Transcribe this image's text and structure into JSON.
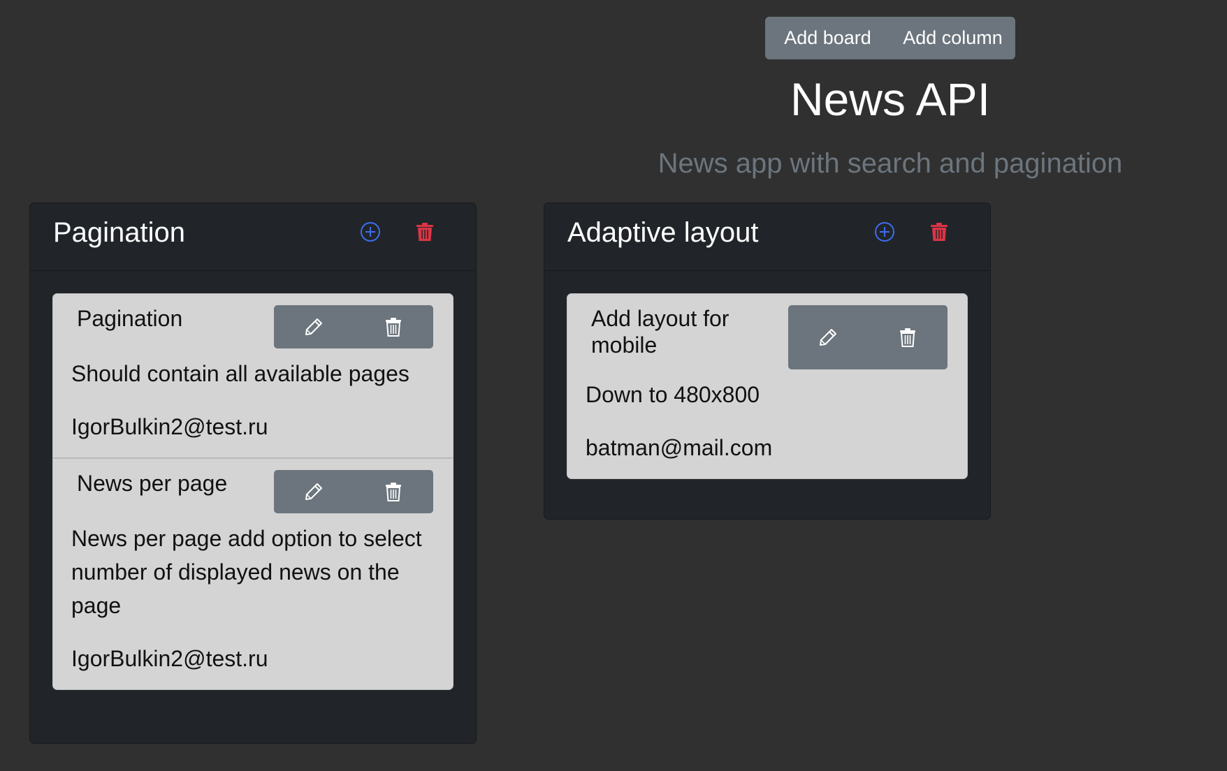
{
  "header": {
    "add_board_label": "Add board",
    "add_column_label": "Add column",
    "title": "News API",
    "subtitle": "News app with search and pagination"
  },
  "colors": {
    "background": "#303030",
    "column_bg": "#212529",
    "card_bg": "#d4d4d4",
    "button_gray": "#6c757d",
    "add_icon": "#3d6df0",
    "delete_icon": "#dc3545"
  },
  "columns": [
    {
      "title": "Pagination",
      "add_icon": "plus-circle-icon",
      "delete_icon": "trash-icon",
      "cards": [
        {
          "title": "Pagination",
          "description": "Should contain all available pages",
          "email": "IgorBulkin2@test.ru",
          "edit_icon": "pencil-icon",
          "delete_icon": "trash-icon"
        },
        {
          "title": "News per page",
          "description": "News per page add option to select number of displayed news on the page",
          "email": "IgorBulkin2@test.ru",
          "edit_icon": "pencil-icon",
          "delete_icon": "trash-icon"
        }
      ]
    },
    {
      "title": "Adaptive layout",
      "add_icon": "plus-circle-icon",
      "delete_icon": "trash-icon",
      "cards": [
        {
          "title": "Add layout for mobile",
          "description": "Down to 480x800",
          "email": "batman@mail.com",
          "edit_icon": "pencil-icon",
          "delete_icon": "trash-icon"
        }
      ]
    }
  ]
}
